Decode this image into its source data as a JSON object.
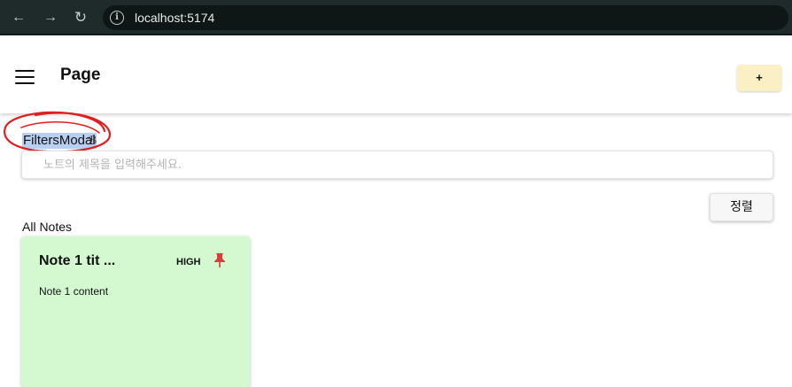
{
  "browser": {
    "url": "localhost:5174",
    "back_icon": "arrow-left-icon",
    "forward_icon": "arrow-right-icon",
    "reload_icon": "reload-icon",
    "info_icon": "info-icon"
  },
  "header": {
    "title": "Page",
    "menu_icon": "hamburger-menu-icon",
    "add_label": "+",
    "add_color": "#fbefc6"
  },
  "filters": {
    "label": "FiltersModal",
    "title_placeholder": "노트의 제목을 입력해주세요.",
    "sort_label": "정렬"
  },
  "notes": {
    "section_label": "All Notes",
    "items": [
      {
        "title": "Note 1 tit ...",
        "priority": "HIGH",
        "content": "Note 1 content",
        "pin_icon": "pin-icon",
        "color": "#d4f9d0"
      }
    ]
  }
}
